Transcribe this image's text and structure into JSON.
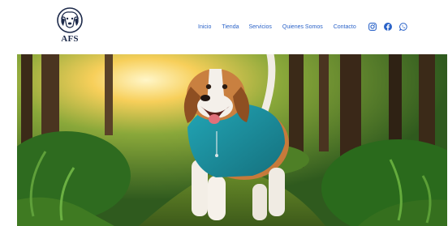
{
  "header": {
    "logo": {
      "text": "AFS",
      "icon": "dog-face-logo"
    },
    "nav": [
      {
        "label": "Inicio"
      },
      {
        "label": "Tienda"
      },
      {
        "label": "Servicios"
      },
      {
        "label": "Quienes Somos"
      },
      {
        "label": "Contacto"
      }
    ],
    "social": [
      "instagram-icon",
      "facebook-icon",
      "whatsapp-icon"
    ]
  },
  "hero": {
    "image": "beagle wearing teal hoodie walking on forest path",
    "accent_color": "#1f9db0"
  },
  "colors": {
    "nav_link": "#2b63c8",
    "logo_navy": "#1d2a4a"
  }
}
